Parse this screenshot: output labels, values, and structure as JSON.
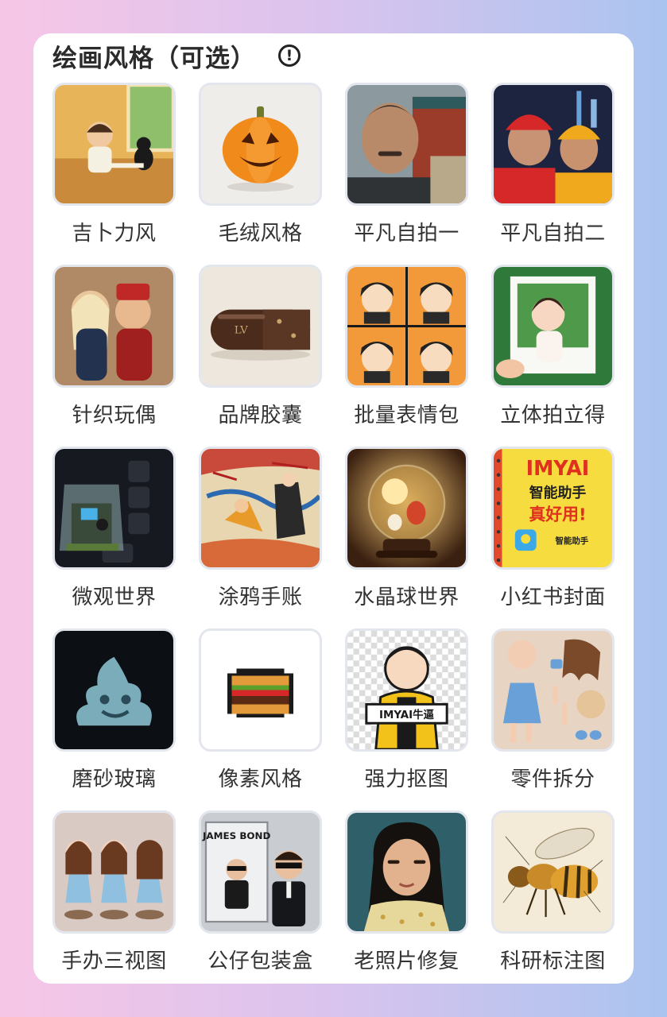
{
  "panel": {
    "title": "绘画风格（可选）",
    "info_icon": "info-circle-icon",
    "info_glyph": "!"
  },
  "styles": [
    {
      "label": "吉卜力风",
      "image": "ghibli-boy-drawing-with-cat"
    },
    {
      "label": "毛绒风格",
      "image": "felt-pumpkin"
    },
    {
      "label": "平凡自拍一",
      "image": "man-selfie-temple"
    },
    {
      "label": "平凡自拍二",
      "image": "delivery-riders-selfie"
    },
    {
      "label": "针织玩偶",
      "image": "knitted-dolls-couple"
    },
    {
      "label": "品牌胶囊",
      "image": "brand-capsule-pill"
    },
    {
      "label": "批量表情包",
      "image": "sticker-grid-girl"
    },
    {
      "label": "立体拍立得",
      "image": "3d-girl-polaroid"
    },
    {
      "label": "微观世界",
      "image": "keycap-micro-room"
    },
    {
      "label": "涂鸦手账",
      "image": "doodle-journal"
    },
    {
      "label": "水晶球世界",
      "image": "crystal-ball"
    },
    {
      "label": "小红书封面",
      "image": "xiaohongshu-cover",
      "cover_lines": [
        "IMYAI",
        "智能助手",
        "真好用!"
      ],
      "cover_badge": "智能助手"
    },
    {
      "label": "磨砂玻璃",
      "image": "frosted-glass-emoji"
    },
    {
      "label": "像素风格",
      "image": "pixel-burger"
    },
    {
      "label": "强力抠图",
      "image": "cartoon-boy-cutout",
      "sign_text": "IMYAI牛逼"
    },
    {
      "label": "零件拆分",
      "image": "doll-parts-flatlay"
    },
    {
      "label": "手办三视图",
      "image": "figure-three-views"
    },
    {
      "label": "公仔包装盒",
      "image": "toy-box-james-bond",
      "box_text": "JAMES BOND"
    },
    {
      "label": "老照片修复",
      "image": "old-photo-girl"
    },
    {
      "label": "科研标注图",
      "image": "annotated-bee"
    }
  ]
}
